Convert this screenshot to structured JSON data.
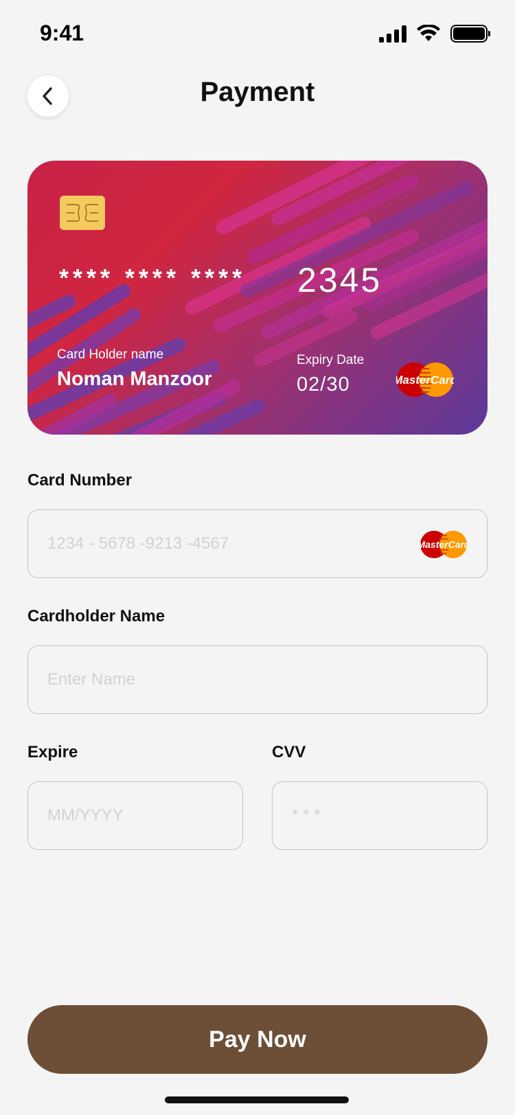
{
  "status_bar": {
    "time": "9:41"
  },
  "header": {
    "title": "Payment"
  },
  "card": {
    "number_mask": "**** **** ****",
    "number_last4": "2345",
    "holder_label": "Card Holder name",
    "holder_name": "Noman Manzoor",
    "expiry_label": "Expiry Date",
    "expiry_value": "02/30",
    "brand": "MasterCard",
    "gradient_colors": [
      "#c72147",
      "#d02640",
      "#a0306e",
      "#5b3a9b"
    ]
  },
  "form": {
    "card_number": {
      "label": "Card Number",
      "placeholder": "1234 - 5678 -9213 -4567",
      "value": ""
    },
    "cardholder_name": {
      "label": "Cardholder Name",
      "placeholder": "Enter Name",
      "value": ""
    },
    "expire": {
      "label": "Expire",
      "placeholder": "MM/YYYY",
      "value": ""
    },
    "cvv": {
      "label": "CVV",
      "placeholder": "* * *",
      "value": ""
    }
  },
  "actions": {
    "pay_label": "Pay Now"
  },
  "colors": {
    "accent": "#6d4e36",
    "background": "#f4f4f4",
    "chip": "#f6c95f"
  }
}
